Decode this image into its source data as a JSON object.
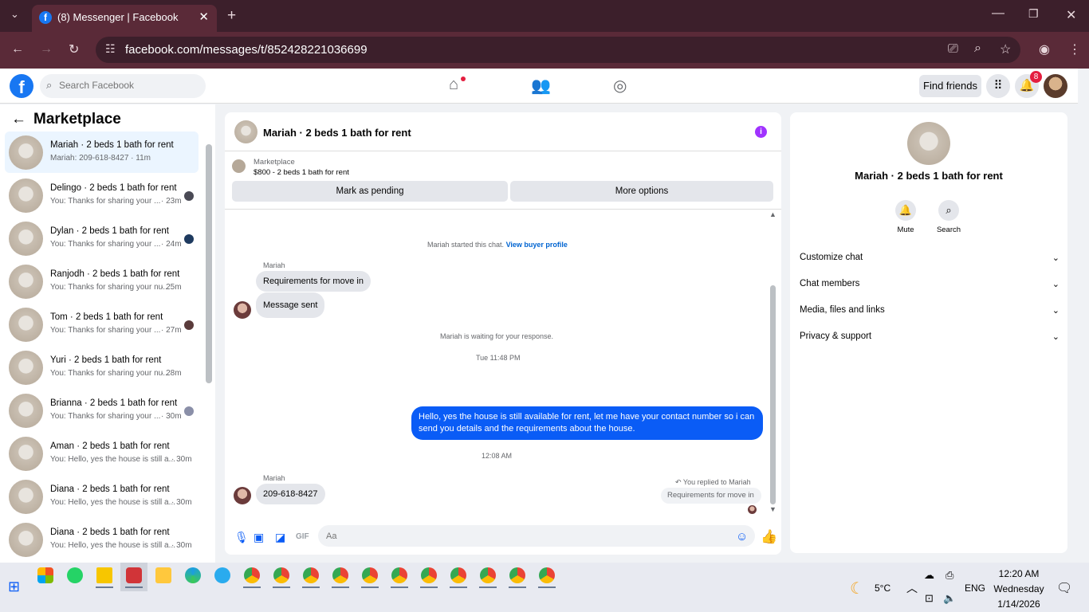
{
  "browser": {
    "tab_title": "(8) Messenger | Facebook",
    "url": "facebook.com/messages/t/852428221036699"
  },
  "fbnav": {
    "search_placeholder": "Search Facebook",
    "find_friends": "Find friends",
    "notification_count": "8"
  },
  "sidebar": {
    "title": "Marketplace",
    "conversations": [
      {
        "name": "Mariah · 2 beds 1 bath for rent",
        "preview": "Mariah: 209-618-8427 · 11m",
        "time": ""
      },
      {
        "name": "Delingo · 2 beds 1 bath for rent",
        "preview": "You: Thanks for sharing your ...",
        "time": "· 23m"
      },
      {
        "name": "Dylan · 2 beds 1 bath for rent",
        "preview": "You: Thanks for sharing your ...",
        "time": "· 24m"
      },
      {
        "name": "Ranjodh · 2 beds 1 bath for rent",
        "preview": "You: Thanks for sharing your nu...",
        "time": "· 25m"
      },
      {
        "name": "Tom · 2 beds 1 bath for rent",
        "preview": "You: Thanks for sharing your ...",
        "time": "· 27m"
      },
      {
        "name": "Yuri · 2 beds 1 bath for rent",
        "preview": "You: Thanks for sharing your nu...",
        "time": "· 28m"
      },
      {
        "name": "Brianna · 2 beds 1 bath for rent",
        "preview": "You: Thanks for sharing your ...",
        "time": "· 30m"
      },
      {
        "name": "Aman · 2 beds 1 bath for rent",
        "preview": "You: Hello, yes the house is still a...",
        "time": "· 30m"
      },
      {
        "name": "Diana · 2 beds 1 bath for rent",
        "preview": "You: Hello, yes the house is still a...",
        "time": "· 30m"
      },
      {
        "name": "Diana · 2 beds 1 bath for rent",
        "preview": "You: Hello, yes the house is still a...",
        "time": "· 30m"
      }
    ]
  },
  "chat": {
    "title": "Mariah · 2 beds 1 bath for rent",
    "marketplace_label": "Marketplace",
    "listing": "$800 - 2 beds 1 bath for rent",
    "mark_pending": "Mark as pending",
    "more_options": "More options",
    "started_text": "Mariah started this chat.",
    "view_buyer_profile": "View buyer profile",
    "sender_name": "Mariah",
    "msg_requirements": "Requirements for move in",
    "msg_sent": "Message sent",
    "waiting_text": "Mariah is waiting for your response.",
    "timestamp_1": "Tue 11:48 PM",
    "replied_to": "You replied to Mariah",
    "quoted": "Requirements for move in",
    "my_reply": "Hello, yes the house is still available for rent, let me have your contact number so i can send you details and the requirements about the house.",
    "timestamp_2": "12:08 AM",
    "sender_name_2": "Mariah",
    "msg_phone": "209-618-8427",
    "input_placeholder": "Aa"
  },
  "rightpanel": {
    "title": "Mariah · 2 beds 1 bath for rent",
    "mute": "Mute",
    "search": "Search",
    "rows": [
      "Customize chat",
      "Chat members",
      "Media, files and links",
      "Privacy & support"
    ]
  },
  "taskbar": {
    "weather": "5°C",
    "lang": "ENG",
    "time": "12:20 AM",
    "day": "Wednesday",
    "date": "1/14/2026"
  },
  "colors": {
    "fb_blue": "#1877f2",
    "outgoing_bubble": "#0a5cf6",
    "chrome_tab": "#5a2a38",
    "info_purple": "#a033ff"
  }
}
